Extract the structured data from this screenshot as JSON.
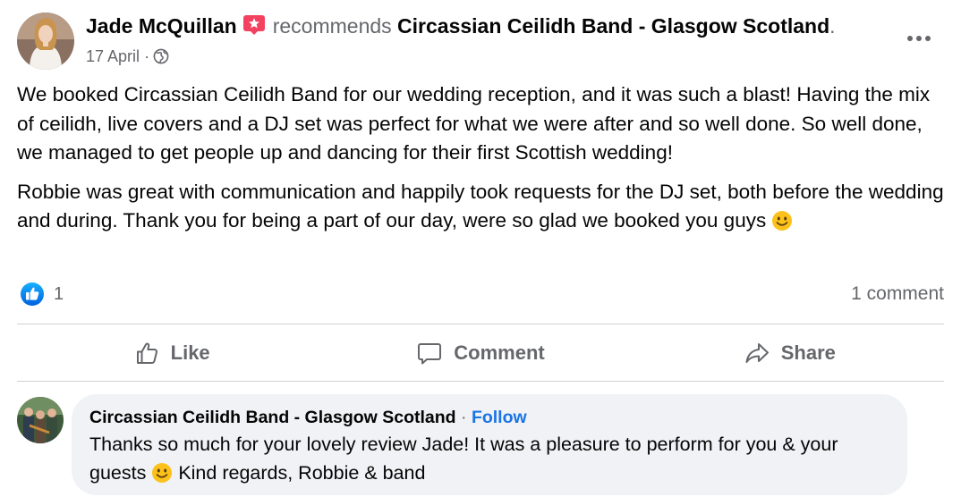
{
  "post": {
    "author": "Jade McQuillan",
    "recommends_word": "recommends",
    "page_name": "Circassian Ceilidh Band - Glasgow Scotland",
    "header_end": ".",
    "date": "17 April",
    "meta_sep": "·",
    "privacy_icon": "globe-icon",
    "paragraphs": [
      "We booked Circassian Ceilidh Band for our wedding reception, and it was such a blast! Having the mix of ceilidh, live covers and a DJ set was perfect for what we were after and so well done. So well done, we managed to get people up and dancing for their first Scottish wedding!",
      "Robbie was great with communication and happily took requests for the DJ set, both before the wedding and during. Thank you for being a part of our day, were so glad we booked you guys"
    ],
    "reaction_count": "1",
    "comment_count": "1 comment"
  },
  "actions": {
    "like": "Like",
    "comment": "Comment",
    "share": "Share"
  },
  "comment": {
    "author": "Circassian Ceilidh Band - Glasgow Scotland",
    "sep": "·",
    "follow": "Follow",
    "text_before_emoji": "Thanks so much for your lovely review Jade! It was a pleasure to perform for you & your guests",
    "text_after_emoji": " Kind regards, Robbie & band"
  },
  "colors": {
    "text_primary": "#050505",
    "text_secondary": "#65676b",
    "link_blue": "#1b74e4",
    "like_blue": "#1877f2",
    "recommend_red": "#f3425f",
    "bubble_bg": "#f0f2f5",
    "divider": "#ced0d4"
  }
}
